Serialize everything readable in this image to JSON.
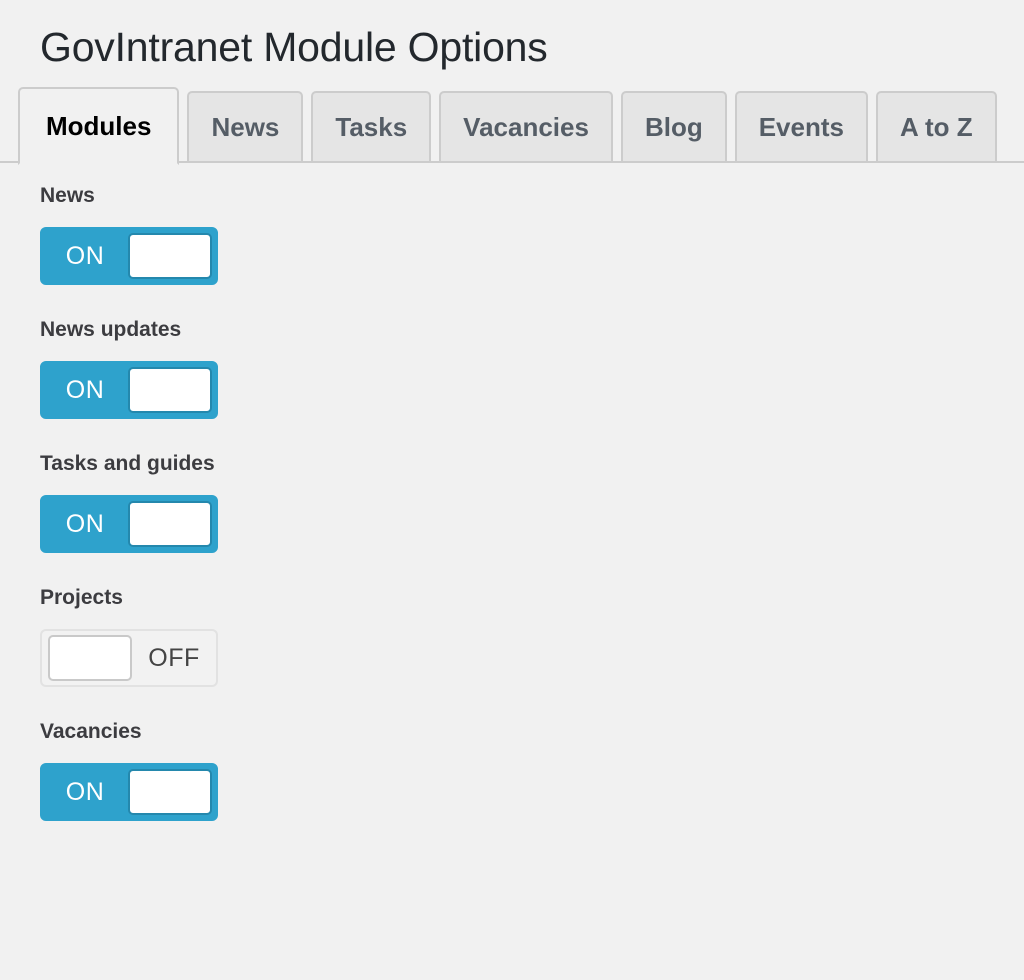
{
  "header": {
    "title": "GovIntranet Module Options"
  },
  "tabs": [
    {
      "label": "Modules",
      "name": "tab-modules",
      "active": true
    },
    {
      "label": "News",
      "name": "tab-news",
      "active": false
    },
    {
      "label": "Tasks",
      "name": "tab-tasks",
      "active": false
    },
    {
      "label": "Vacancies",
      "name": "tab-vacancies",
      "active": false
    },
    {
      "label": "Blog",
      "name": "tab-blog",
      "active": false
    },
    {
      "label": "Events",
      "name": "tab-events",
      "active": false
    },
    {
      "label": "A to Z",
      "name": "tab-a-to-z",
      "active": false
    }
  ],
  "toggle_labels": {
    "on": "ON",
    "off": "OFF"
  },
  "modules": [
    {
      "label": "News",
      "state": "ON",
      "name": "module-news"
    },
    {
      "label": "News updates",
      "state": "ON",
      "name": "module-news-updates"
    },
    {
      "label": "Tasks and guides",
      "state": "ON",
      "name": "module-tasks-and-guides"
    },
    {
      "label": "Projects",
      "state": "OFF",
      "name": "module-projects"
    },
    {
      "label": "Vacancies",
      "state": "ON",
      "name": "module-vacancies"
    }
  ],
  "colors": {
    "page_background": "#f1f1f1",
    "toggle_on_accent": "#2ea2cc",
    "toggle_on_knob_border": "#2488ad",
    "toggle_off_background": "#f2f2f2",
    "toggle_off_border": "#e2e2e2",
    "tab_inactive_background": "#e5e5e5",
    "tab_border": "#cccccc",
    "title_text": "#23282d",
    "label_text": "#3c3c40"
  }
}
